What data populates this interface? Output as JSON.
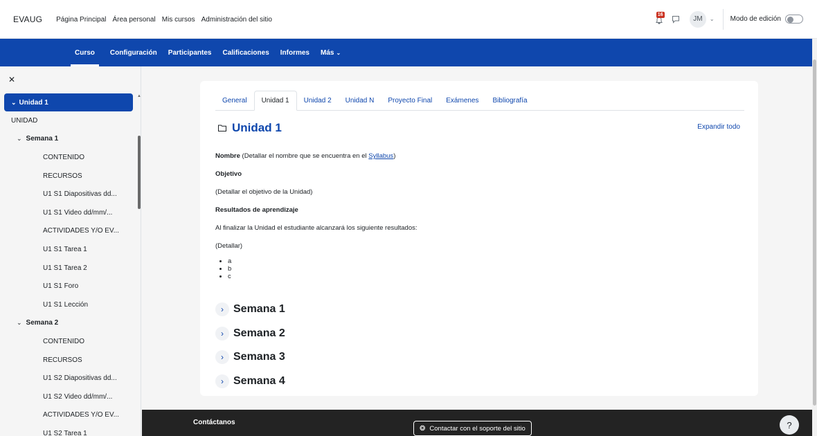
{
  "topbar": {
    "brand": "EVAUG",
    "links": [
      "Página Principal",
      "Área personal",
      "Mis cursos",
      "Administración del sitio"
    ],
    "notification_count": "16",
    "avatar_initials": "JM",
    "edit_mode_label": "Modo de edición"
  },
  "secondary_nav": [
    "Curso",
    "Configuración",
    "Participantes",
    "Calificaciones",
    "Informes",
    "Más"
  ],
  "drawer": {
    "close_icon": "close-icon",
    "active_unit": "Unidad 1",
    "unit_label": "UNIDAD",
    "week1": {
      "title": "Semana 1",
      "items": [
        "CONTENIDO",
        "RECURSOS",
        "U1 S1 Diapositivas dd...",
        "U1 S1 Video dd/mm/...",
        "ACTIVIDADES Y/O EV...",
        "U1 S1 Tarea 1",
        "U1 S1 Tarea 2",
        "U1 S1 Foro",
        "U1 S1 Lección"
      ]
    },
    "week2": {
      "title": "Semana 2",
      "items": [
        "CONTENIDO",
        "RECURSOS",
        "U1 S2 Diapositivas dd...",
        "U1 S2 Video dd/mm/...",
        "ACTIVIDADES Y/O EV...",
        "U1 S2 Tarea 1"
      ]
    }
  },
  "main": {
    "tabs": [
      "General",
      "Unidad 1",
      "Unidad 2",
      "Unidad N",
      "Proyecto Final",
      "Exámenes",
      "Bibliografía"
    ],
    "active_tab": "Unidad 1",
    "heading": "Unidad 1",
    "expand_all": "Expandir todo",
    "nombre_label": "Nombre",
    "nombre_text": " (Detallar el nombre que se encuentra en el ",
    "syllabus_link": "Syllabus",
    "nombre_close": ")",
    "objetivo_label": "Objetivo",
    "objetivo_text": "(Detallar el objetivo de la Unidad)",
    "resultados_label": "Resultados de aprendizaje",
    "resultados_text": "Al finalizar la Unidad el estudiante alcanzará los siguiente resultados:",
    "detallar": "(Detallar)",
    "list": [
      "a",
      "b",
      "c"
    ],
    "weeks": [
      "Semana 1",
      "Semana 2",
      "Semana 3",
      "Semana 4"
    ]
  },
  "footer": {
    "contact": "Contáctanos",
    "support_button": "Contactar con el soporte del sitio",
    "help": "?"
  },
  "colors": {
    "brand_blue": "#0f47ad",
    "footer_bg": "#232323",
    "badge_red": "#ca3120"
  }
}
